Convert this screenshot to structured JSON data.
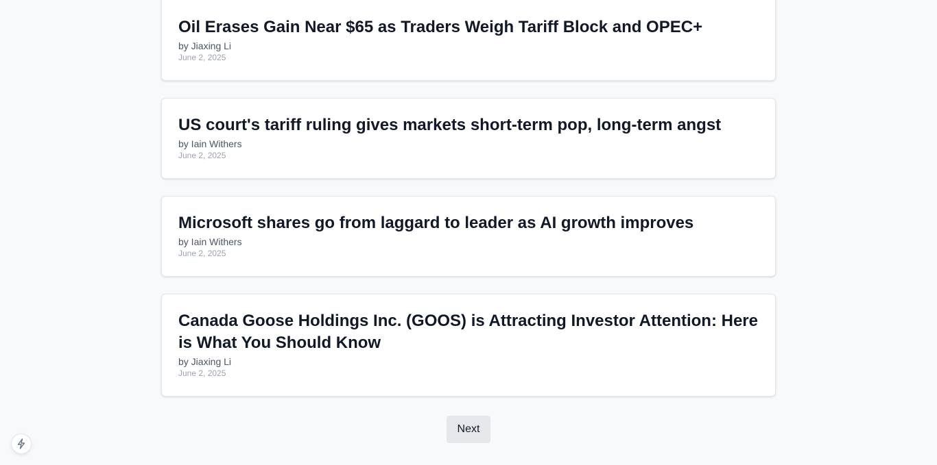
{
  "articles": [
    {
      "title": "Oil Erases Gain Near $65 as Traders Weigh Tariff Block and OPEC+",
      "author": "by Jiaxing Li",
      "date": "June 2, 2025"
    },
    {
      "title": "US court's tariff ruling gives markets short-term pop, long-term angst",
      "author": "by Iain Withers",
      "date": "June 2, 2025"
    },
    {
      "title": "Microsoft shares go from laggard to leader as AI growth improves",
      "author": "by Iain Withers",
      "date": "June 2, 2025"
    },
    {
      "title": "Canada Goose Holdings Inc. (GOOS) is Attracting Investor Attention: Here is What You Should Know",
      "author": "by Jiaxing Li",
      "date": "June 2, 2025"
    }
  ],
  "pagination": {
    "next_label": "Next"
  },
  "dev_badge": {
    "icon": "lightning-bolt-icon"
  },
  "colors": {
    "background": "#f8f9fa",
    "card": "#ffffff",
    "title": "#111827",
    "button": "#e5e7eb"
  }
}
